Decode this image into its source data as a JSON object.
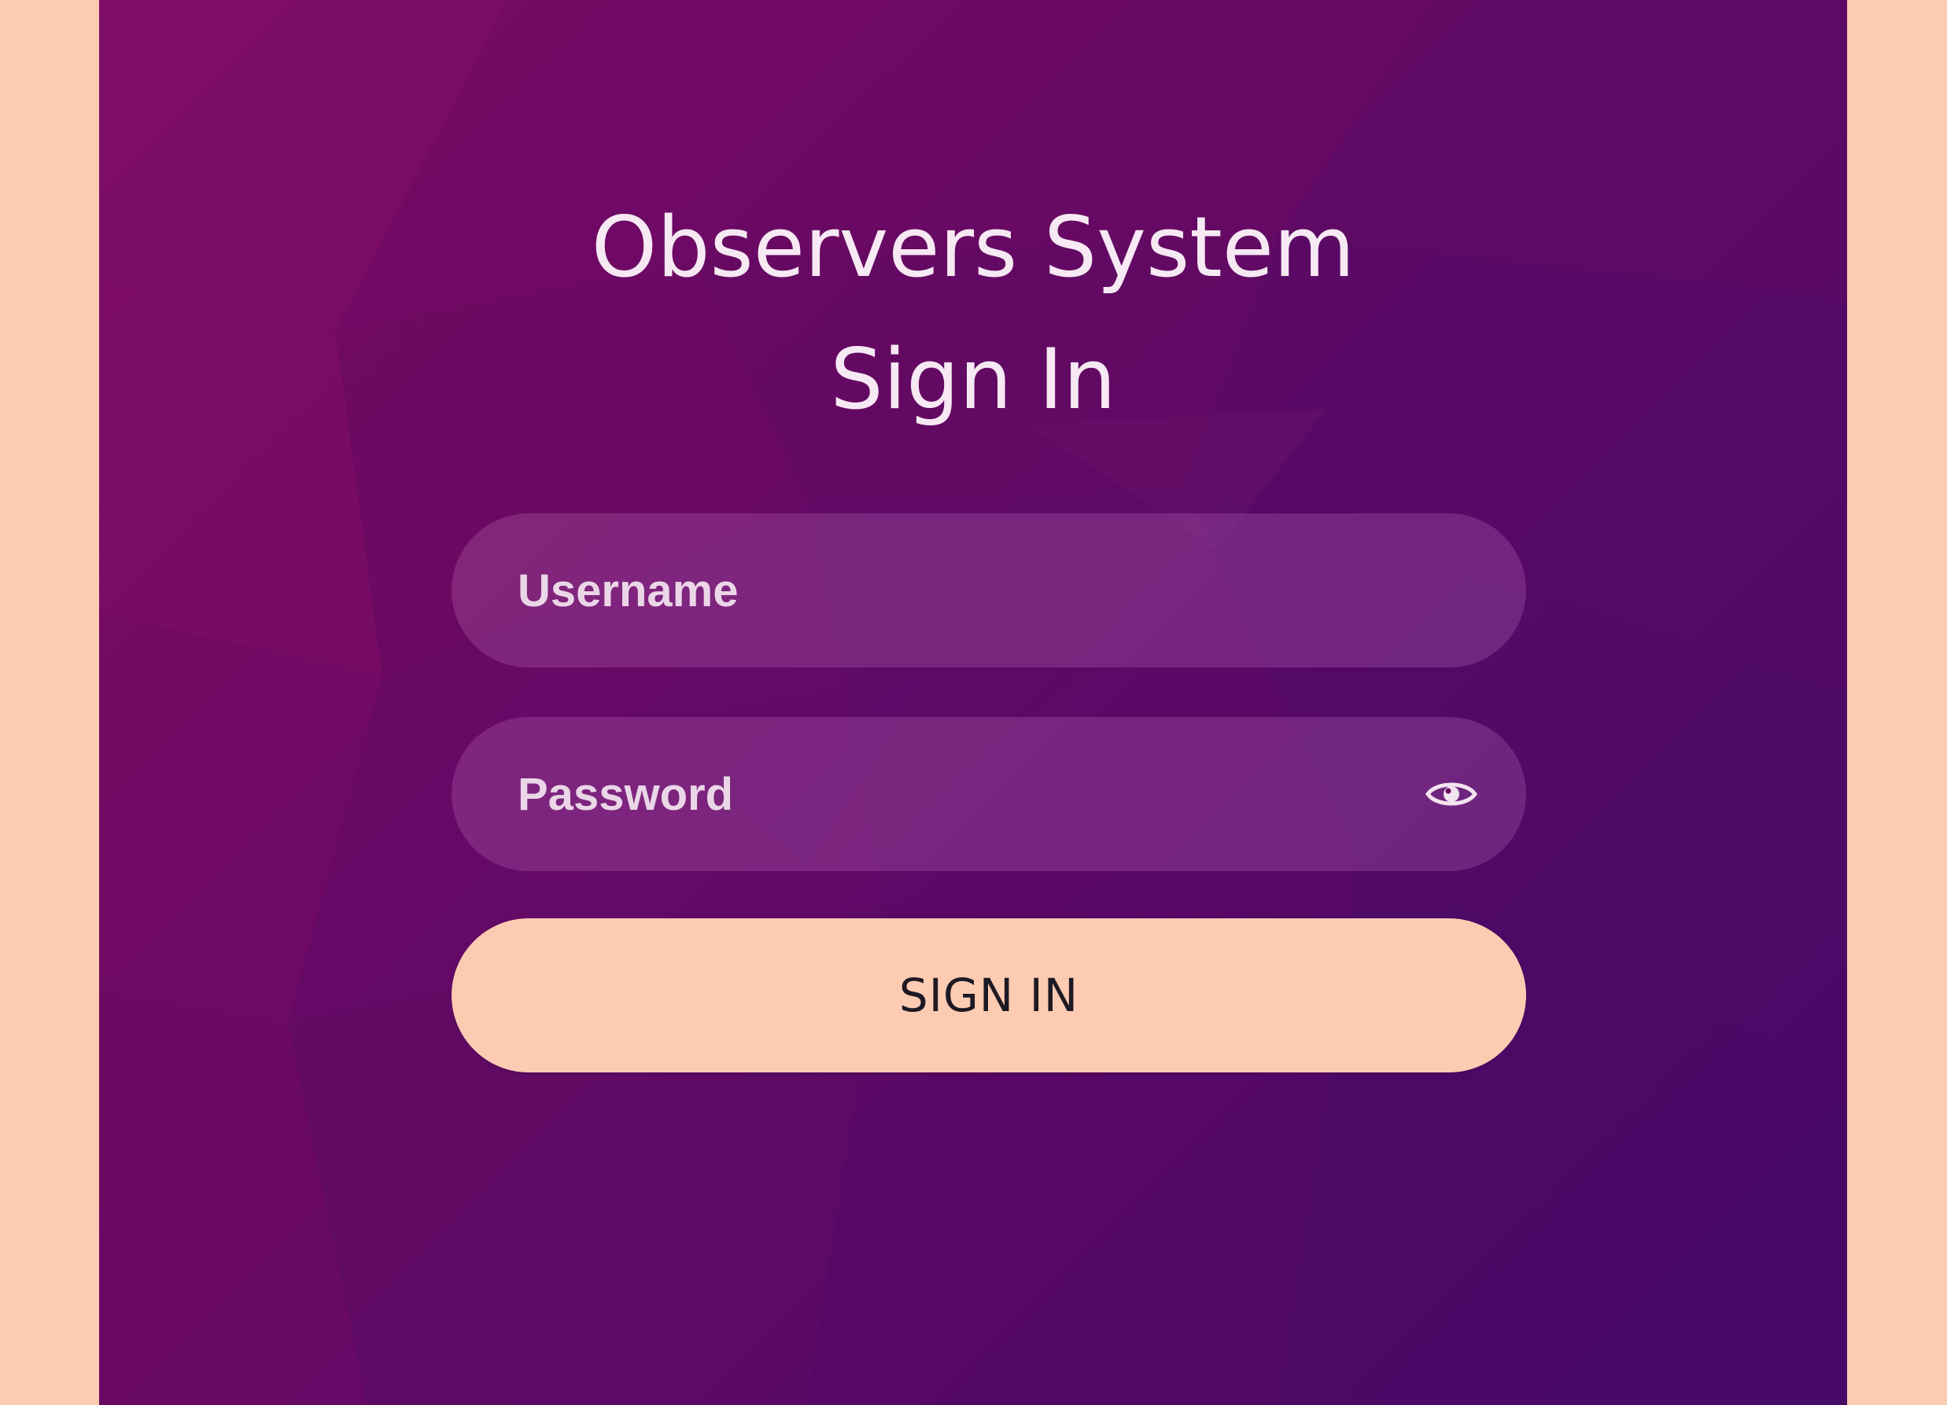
{
  "header": {
    "title": "Observers System",
    "subtitle": "Sign In"
  },
  "form": {
    "username": {
      "placeholder": "Username",
      "value": ""
    },
    "password": {
      "placeholder": "Password",
      "value": "",
      "toggle_icon": "eye-icon"
    },
    "submit_label": "SIGN IN"
  },
  "colors": {
    "page_background": "#FCCBB2",
    "panel_gradient_start": "#7A0B62",
    "panel_gradient_end": "#480A68",
    "button_background": "#FCCBB2",
    "button_text": "#1E1A24",
    "heading_text": "#F6E9F3"
  }
}
